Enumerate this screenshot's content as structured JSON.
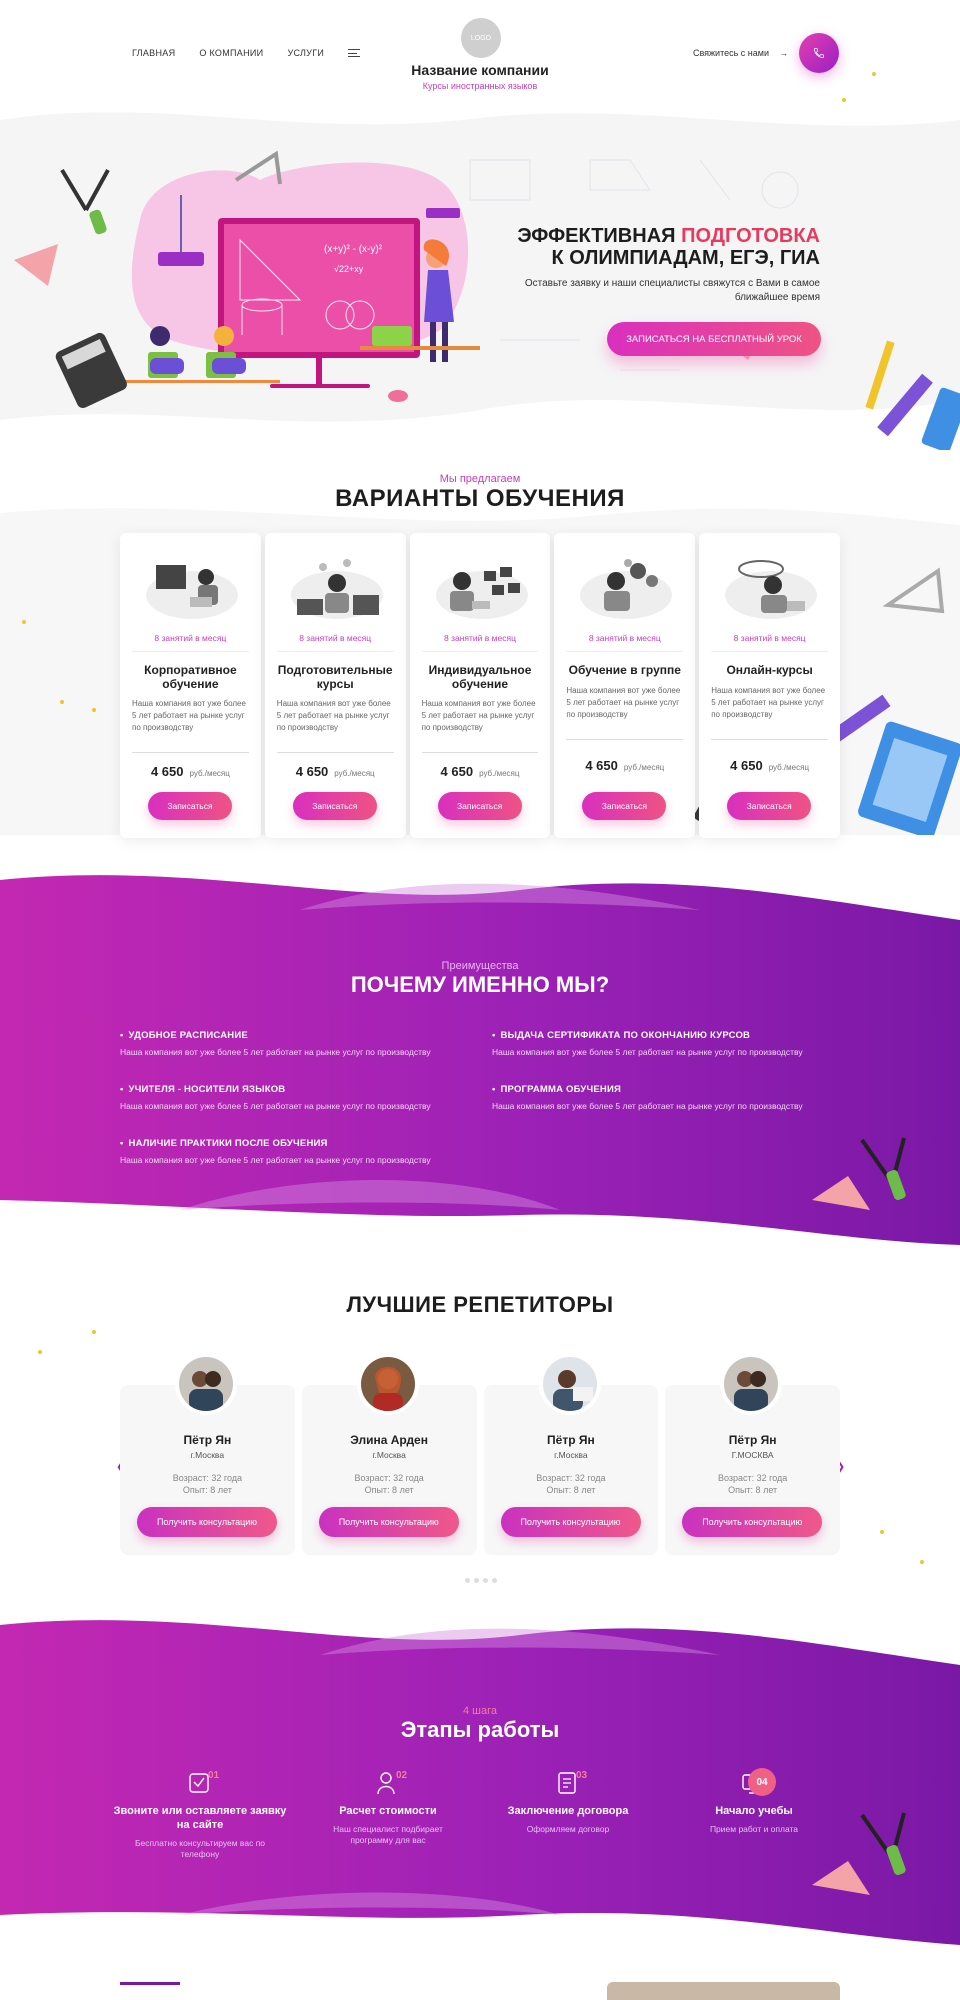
{
  "header": {
    "nav": [
      "ГЛАВНАЯ",
      "О КОМПАНИИ",
      "УСЛУГИ"
    ],
    "logo_text": "LOGO",
    "company_name": "Название компании",
    "company_subtitle": "Курсы иностранных языков",
    "contact_label": "Свяжитесь с нами"
  },
  "hero": {
    "title_part1": "ЭФФЕКТИВНАЯ ",
    "title_accent": "ПОДГОТОВКА",
    "title_line2": "К ОЛИМПИАДАМ, ЕГЭ, ГИА",
    "text": "Оставьте заявку и наши специалисты свяжутся с Вами в самое ближайшее время",
    "button": "ЗАПИСАТЬСЯ НА БЕСПЛАТНЫЙ УРОК"
  },
  "courses": {
    "kicker": "Мы предлагаем",
    "title": "ВАРИАНТЫ ОБУЧЕНИЯ",
    "items": [
      {
        "per": "8 занятий в месяц",
        "title": "Корпоративное обучение",
        "desc": "Наша компания вот уже более 5 лет работает на рынке услуг по производству",
        "price": "4 650",
        "unit": "руб./месяц",
        "button": "Записаться"
      },
      {
        "per": "8 занятий в месяц",
        "title": "Подготовительные курсы",
        "desc": "Наша компания вот уже более 5 лет работает на рынке услуг по производству",
        "price": "4 650",
        "unit": "руб./месяц",
        "button": "Записаться"
      },
      {
        "per": "8 занятий в месяц",
        "title": "Индивидуальное обучение",
        "desc": "Наша компания вот уже более 5 лет работает на рынке услуг по производству",
        "price": "4 650",
        "unit": "руб./месяц",
        "button": "Записаться"
      },
      {
        "per": "8 занятий в месяц",
        "title": "Обучение в группе",
        "desc": "Наша компания вот уже более 5 лет работает на рынке услуг по производству",
        "price": "4 650",
        "unit": "руб./месяц",
        "button": "Записаться"
      },
      {
        "per": "8 занятий в месяц",
        "title": "Онлайн-курсы",
        "desc": "Наша компания вот уже более 5 лет работает на рынке услуг по производству",
        "price": "4 650",
        "unit": "руб./месяц",
        "button": "Записаться"
      }
    ]
  },
  "why": {
    "kicker": "Преимущества",
    "title": "ПОЧЕМУ ИМЕННО МЫ?",
    "items": [
      {
        "title": "УДОБНОЕ РАСПИСАНИЕ",
        "desc": "Наша компания вот уже более 5 лет работает на рынке услуг по производству"
      },
      {
        "title": "ВЫДАЧА СЕРТИФИКАТА ПО ОКОНЧАНИЮ КУРСОВ",
        "desc": "Наша компания вот уже более 5 лет работает на рынке услуг по производству"
      },
      {
        "title": "УЧИТЕЛЯ - НОСИТЕЛИ ЯЗЫКОВ",
        "desc": "Наша компания вот уже более 5 лет работает на рынке услуг по производству"
      },
      {
        "title": "ПРОГРАММА ОБУЧЕНИЯ",
        "desc": "Наша компания вот уже более 5 лет работает на рынке услуг по производству"
      },
      {
        "title": "НАЛИЧИЕ ПРАКТИКИ ПОСЛЕ ОБУЧЕНИЯ",
        "desc": "Наша компания вот уже более 5 лет работает на рынке услуг по производству"
      }
    ]
  },
  "tutors": {
    "title": "ЛУЧШИЕ РЕПЕТИТОРЫ",
    "items": [
      {
        "name": "Пётр Ян",
        "city": "г.Москва",
        "age": "Возраст: 32 года",
        "exp": "Опыт: 8 лет",
        "button": "Получить консультацию"
      },
      {
        "name": "Элина Арден",
        "city": "г.Москва",
        "age": "Возраст: 32 года",
        "exp": "Опыт: 8 лет",
        "button": "Получить консультацию"
      },
      {
        "name": "Пётр Ян",
        "city": "г.Москва",
        "age": "Возраст: 32 года",
        "exp": "Опыт: 8 лет",
        "button": "Получить консультацию"
      },
      {
        "name": "Пётр Ян",
        "city": "Г.МОСКВА",
        "age": "Возраст: 32 года",
        "exp": "Опыт: 8 лет",
        "button": "Получить консультацию"
      }
    ]
  },
  "steps": {
    "kicker": "4 шага",
    "title": "Этапы работы",
    "items": [
      {
        "num": "01",
        "title": "Звоните или оставляете заявку на сайте",
        "desc": "Бесплатно консультируем вас по телефону"
      },
      {
        "num": "02",
        "title": "Расчет стоимости",
        "desc": "Наш специалист подбирает программу для вас"
      },
      {
        "num": "03",
        "title": "Заключение договора",
        "desc": "Оформляем договор"
      },
      {
        "num": "04",
        "title": "Начало учебы",
        "desc": "Прием работ и оплата"
      }
    ]
  },
  "colors": {
    "accent": "#c63fb7",
    "brand_gradient_start": "#d92fbf",
    "brand_gradient_end": "#ef5383",
    "band": "#9c21b6"
  }
}
